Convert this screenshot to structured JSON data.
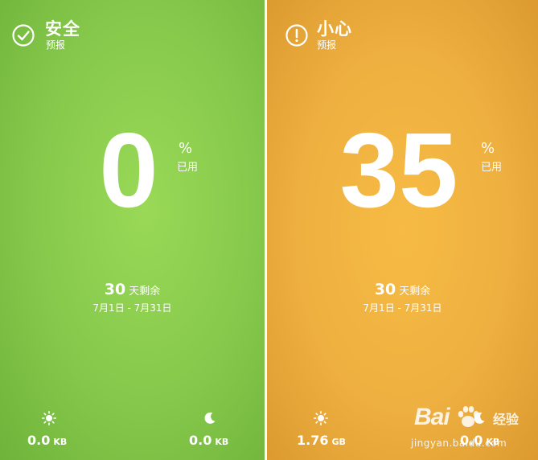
{
  "colors": {
    "safe": "#85c84b",
    "caution": "#eeb040",
    "text": "#ffffff"
  },
  "panels": [
    {
      "status": {
        "icon": "check-circle-icon",
        "title": "安全",
        "subtitle": "预报"
      },
      "usage": {
        "value": "0",
        "percent_sign": "%",
        "label": "已用"
      },
      "remaining": {
        "days": "30",
        "label": "天剩余",
        "range": "7月1日 - 7月31日"
      },
      "day": {
        "icon": "sun-icon",
        "value": "0.0",
        "unit": "KB"
      },
      "night": {
        "icon": "moon-icon",
        "value": "0.0",
        "unit": "KB"
      }
    },
    {
      "status": {
        "icon": "exclamation-circle-icon",
        "title": "小心",
        "subtitle": "预报"
      },
      "usage": {
        "value": "35",
        "percent_sign": "%",
        "label": "已用"
      },
      "remaining": {
        "days": "30",
        "label": "天剩余",
        "range": "7月1日 - 7月31日"
      },
      "day": {
        "icon": "sun-icon",
        "value": "1.76",
        "unit": "GB"
      },
      "night": {
        "icon": "moon-icon",
        "value": "0.0",
        "unit": "KB"
      }
    }
  ],
  "watermark": {
    "logo": "Bai",
    "logo_suffix": "经验",
    "url": "jingyan.baidu.com"
  }
}
